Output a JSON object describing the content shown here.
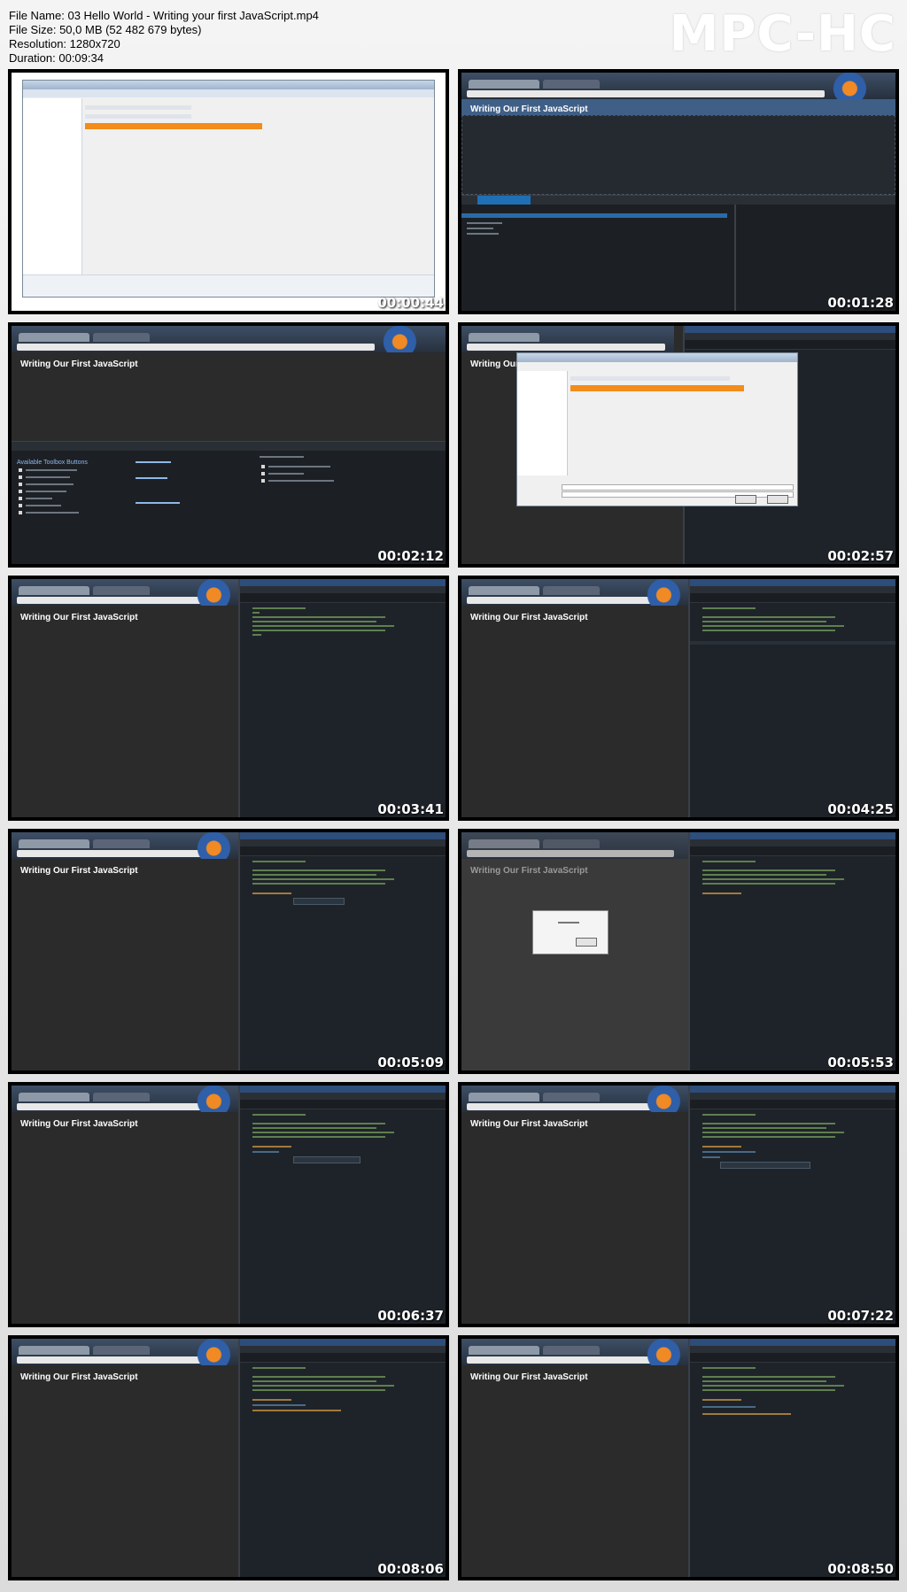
{
  "file": {
    "name_line": "File Name: 03 Hello World - Writing your first JavaScript.mp4",
    "size_line": "File Size: 50,0 MB (52 482 679 bytes)",
    "resolution_line": "Resolution: 1280x720",
    "duration_line": "Duration: 00:09:34"
  },
  "logo": "MPC-HC",
  "thumbnails": [
    {
      "time": "00:00:44",
      "page_heading": ""
    },
    {
      "time": "00:01:28",
      "page_heading": "Writing Our First JavaScript"
    },
    {
      "time": "00:02:12",
      "page_heading": "Writing Our First JavaScript"
    },
    {
      "time": "00:02:57",
      "page_heading": "Writing Our"
    },
    {
      "time": "00:03:41",
      "page_heading": "Writing Our First JavaScript"
    },
    {
      "time": "00:04:25",
      "page_heading": "Writing Our First JavaScript"
    },
    {
      "time": "00:05:09",
      "page_heading": "Writing Our First JavaScript"
    },
    {
      "time": "00:05:53",
      "page_heading": "Writing Our First JavaScript"
    },
    {
      "time": "00:06:37",
      "page_heading": "Writing Our First JavaScript"
    },
    {
      "time": "00:07:22",
      "page_heading": "Writing Our First JavaScript"
    },
    {
      "time": "00:08:06",
      "page_heading": "Writing Our First JavaScript"
    },
    {
      "time": "00:08:50",
      "page_heading": "Writing Our First JavaScript"
    }
  ],
  "devtools_panel": {
    "heading": "Available Toolbox Buttons"
  }
}
